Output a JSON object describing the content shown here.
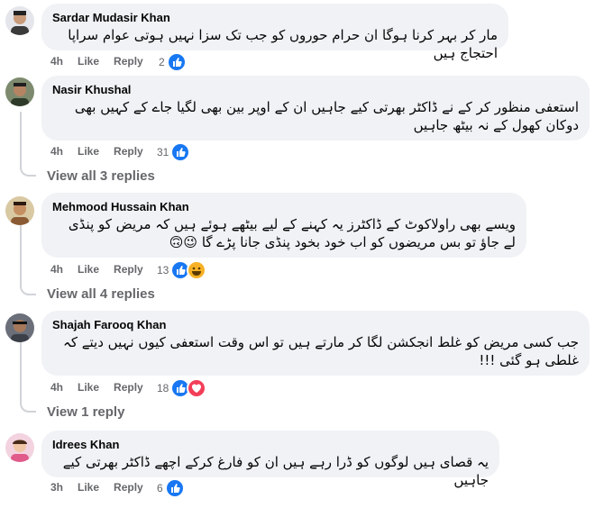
{
  "colors": {
    "like": "#1877f2",
    "love": "#f33e58",
    "haha": "#f7b125",
    "muted": "#65676b"
  },
  "actions": {
    "like": "Like",
    "reply": "Reply"
  },
  "comments": [
    {
      "author": "Sardar Mudasir Khan",
      "text": "مار کر بہر کرنا ہوگا ان حرام حوروں کو جب تک سزا نہیں ہوتی عوام سراپا احتجاج ہیں",
      "time": "4h",
      "reactions": "2",
      "reaction_icons": [
        "like-icon"
      ]
    },
    {
      "author": "Nasir Khushal",
      "text": "استعفی منظور کر کے نے ڈاکٹر بھرتی کیے جاہیں ان کے اوپر بین بھی لگیا جاے کے کہیں بھی دوکان کھول کے نہ بیٹھ جاہیں",
      "time": "4h",
      "reactions": "31",
      "reaction_icons": [
        "like-icon"
      ],
      "view_replies": "View all 3 replies"
    },
    {
      "author": "Mehmood Hussain Khan",
      "text": "ویسے بھی راولاکوٹ کے ڈاکٹرز یہ کہنے کے لیے بیٹھے ہوئے ہیں کہ مریض کو پنڈی لے جاؤ تو بس مریضوں کو اب خود بخود پنڈی جانا پڑے گا 😉🙃",
      "time": "4h",
      "reactions": "13",
      "reaction_icons": [
        "like-icon",
        "haha-icon"
      ],
      "view_replies": "View all 4 replies"
    },
    {
      "author": "Shajah Farooq Khan",
      "text": "جب کسی مریض کو غلط انجکشن لگا کر مارتے ہیں تو اس وقت استعفی کیوں نہیں دیتے کہ غلطی ہو گئی !!!",
      "time": "4h",
      "reactions": "18",
      "reaction_icons": [
        "like-icon",
        "love-icon"
      ],
      "view_replies": "View 1 reply"
    },
    {
      "author": "Idrees Khan",
      "text": "یہ قصای ہیں لوگوں کو ڈرا رہے ہیں ان کو فارغ کرکے اچھے ڈاکٹر بھرتی کیے جاہیں",
      "time": "3h",
      "reactions": "6",
      "reaction_icons": [
        "like-icon"
      ]
    }
  ]
}
